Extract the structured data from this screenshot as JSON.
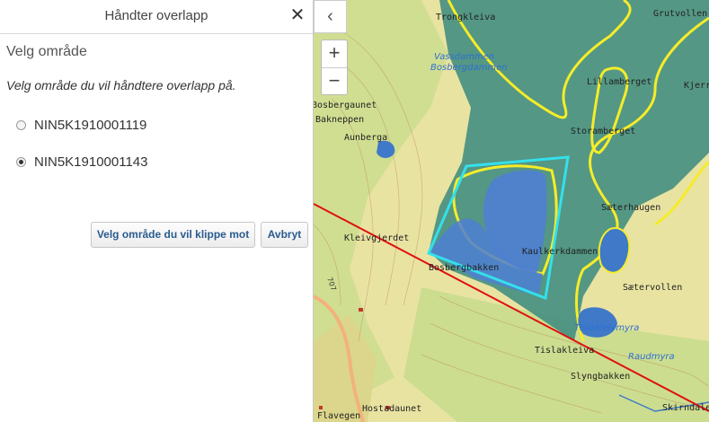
{
  "panel": {
    "title": "Håndter overlapp",
    "close_glyph": "✕",
    "section_title": "Velg område",
    "instruction": "Velg område du vil håndtere overlapp på.",
    "options": [
      {
        "label": "NIN5K1910001119",
        "checked": false
      },
      {
        "label": "NIN5K1910001143",
        "checked": true
      }
    ],
    "buttons": {
      "clip": "Velg område du vil klippe mot",
      "cancel": "Avbryt"
    }
  },
  "map": {
    "collapse_glyph": "‹",
    "zoom_in": "+",
    "zoom_out": "−",
    "place_names": [
      "Trongkleiva",
      "Grutvollen",
      "Vassdammen",
      "Bosbergdammen",
      "Lillamberget",
      "Kjerri",
      "Storamberget",
      "Aunberga",
      "Bosbergaunet",
      "Bakneppen",
      "Sæterhaugen",
      "Kleivgjerdet",
      "Kaulkerkdammen",
      "Bosbergbakken",
      "Sætervollen",
      "Tislakleivmyra",
      "Tislakleiva",
      "Raudmyra",
      "Slyngbakken",
      "Hostadaunet",
      "Skirndalen",
      "Flavegen",
      "707"
    ],
    "colors": {
      "terrain": "#e9e3a2",
      "forest": "#c9dc8e",
      "overlap_fill": "#3f8c80",
      "polygon_outline": "#f5ec2a",
      "selected_outline": "#34e0ec",
      "selected_fill": "#4f7fd2",
      "cut_line": "#e01010",
      "water": "#3f79c8"
    }
  }
}
